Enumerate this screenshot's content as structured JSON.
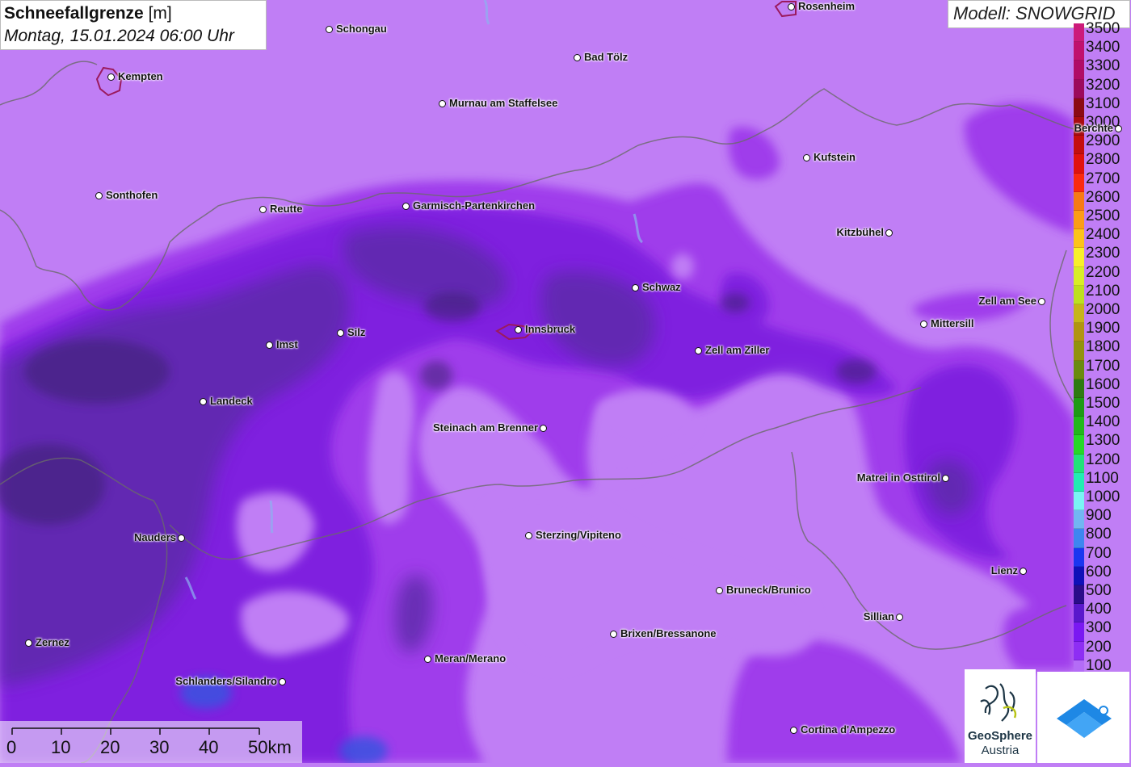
{
  "title": {
    "main": "Schneefallgrenze",
    "unit": "[m]",
    "datetime": "Montag, 15.01.2024 06:00 Uhr"
  },
  "model_label": "Modell: SNOWGRID",
  "legend": {
    "rows": [
      {
        "label": "3500",
        "color": "#cc1a7a"
      },
      {
        "label": "3400",
        "color": "#c0106e"
      },
      {
        "label": "3300",
        "color": "#b00c66"
      },
      {
        "label": "3200",
        "color": "#9c0a5c"
      },
      {
        "label": "3100",
        "color": "#8b0a14"
      },
      {
        "label": "3000",
        "color": "#a80c10"
      },
      {
        "label": "2900",
        "color": "#c40e0e"
      },
      {
        "label": "2800",
        "color": "#e0120e"
      },
      {
        "label": "2700",
        "color": "#fa2a10"
      },
      {
        "label": "2600",
        "color": "#f77a14"
      },
      {
        "label": "2500",
        "color": "#fb9d16"
      },
      {
        "label": "2400",
        "color": "#fcc31a"
      },
      {
        "label": "2300",
        "color": "#f8f02a"
      },
      {
        "label": "2200",
        "color": "#d8ee28"
      },
      {
        "label": "2100",
        "color": "#bde020"
      },
      {
        "label": "2000",
        "color": "#c6b41a"
      },
      {
        "label": "1900",
        "color": "#b19412"
      },
      {
        "label": "1800",
        "color": "#92920e"
      },
      {
        "label": "1700",
        "color": "#6a8a10"
      },
      {
        "label": "1600",
        "color": "#2e7a12"
      },
      {
        "label": "1500",
        "color": "#1e9a16"
      },
      {
        "label": "1400",
        "color": "#22b81c"
      },
      {
        "label": "1300",
        "color": "#26d828"
      },
      {
        "label": "1200",
        "color": "#22e27a"
      },
      {
        "label": "1100",
        "color": "#22ecb2"
      },
      {
        "label": "1000",
        "color": "#7af4f4"
      },
      {
        "label": "900",
        "color": "#72b6f2"
      },
      {
        "label": "800",
        "color": "#3e86f0"
      },
      {
        "label": "700",
        "color": "#1a36f0"
      },
      {
        "label": "600",
        "color": "#1010b8"
      },
      {
        "label": "500",
        "color": "#2a0c8a"
      },
      {
        "label": "400",
        "color": "#5a18cc"
      },
      {
        "label": "300",
        "color": "#7a18f2"
      },
      {
        "label": "200",
        "color": "#8e2ef4"
      },
      {
        "label": "100",
        "color": "#b46cf6"
      }
    ]
  },
  "cities": [
    {
      "name": "Schongau",
      "side": "right"
    },
    {
      "name": "Rosenheim",
      "side": "right"
    },
    {
      "name": "Kempten",
      "side": "right"
    },
    {
      "name": "Bad Tölz",
      "side": "right"
    },
    {
      "name": "Murnau am Staffelsee",
      "side": "right"
    },
    {
      "name": "Berchte",
      "side": "left"
    },
    {
      "name": "Kufstein",
      "side": "right"
    },
    {
      "name": "Sonthofen",
      "side": "right"
    },
    {
      "name": "Reutte",
      "side": "right"
    },
    {
      "name": "Garmisch-Partenkirchen",
      "side": "right"
    },
    {
      "name": "Kitzbühel",
      "side": "left"
    },
    {
      "name": "Schwaz",
      "side": "right"
    },
    {
      "name": "Zell am See",
      "side": "left"
    },
    {
      "name": "Mittersill",
      "side": "right"
    },
    {
      "name": "Silz",
      "side": "right"
    },
    {
      "name": "Innsbruck",
      "side": "right"
    },
    {
      "name": "Imst",
      "side": "right"
    },
    {
      "name": "Zell am Ziller",
      "side": "right"
    },
    {
      "name": "Landeck",
      "side": "right"
    },
    {
      "name": "Steinach am Brenner",
      "side": "left"
    },
    {
      "name": "Matrei in Osttirol",
      "side": "left"
    },
    {
      "name": "Nauders",
      "side": "left"
    },
    {
      "name": "Sterzing/Vipiteno",
      "side": "right"
    },
    {
      "name": "Lienz",
      "side": "left"
    },
    {
      "name": "Bruneck/Brunico",
      "side": "right"
    },
    {
      "name": "Sillian",
      "side": "left"
    },
    {
      "name": "Brixen/Bressanone",
      "side": "right"
    },
    {
      "name": "Zernez",
      "side": "right"
    },
    {
      "name": "Meran/Merano",
      "side": "right"
    },
    {
      "name": "Schlanders/Silandro",
      "side": "left"
    },
    {
      "name": "Cortina d'Ampezzo",
      "side": "right"
    }
  ],
  "scale_bar": {
    "labels": [
      "0",
      "10",
      "20",
      "30",
      "40",
      "50km"
    ]
  },
  "logos": {
    "geosphere_line1": "GeoSphere",
    "geosphere_line2": "Austria"
  }
}
